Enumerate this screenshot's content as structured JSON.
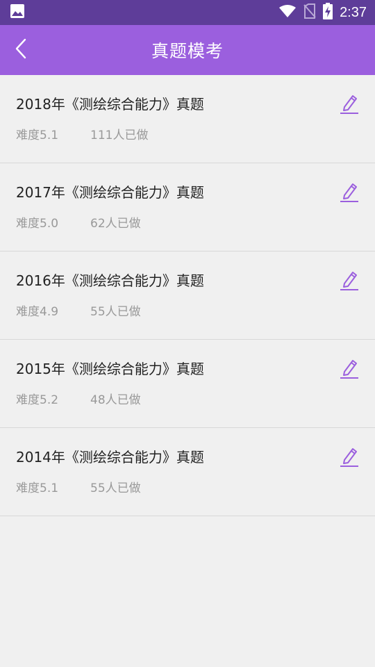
{
  "status_bar": {
    "time": "2:37",
    "icons": [
      "image-icon",
      "wifi-icon",
      "no-sim-icon",
      "battery-charging-icon"
    ]
  },
  "header": {
    "title": "真题模考",
    "back_icon": "back-arrow-icon"
  },
  "colors": {
    "status_bar": "#5e3d99",
    "app_bar": "#9b5fde",
    "accent": "#9b5fde",
    "background": "#f0f0f0"
  },
  "exams": [
    {
      "title": "2018年《测绘综合能力》真题",
      "difficulty": "难度5.1",
      "participants": "111人已做"
    },
    {
      "title": "2017年《测绘综合能力》真题",
      "difficulty": "难度5.0",
      "participants": "62人已做"
    },
    {
      "title": "2016年《测绘综合能力》真题",
      "difficulty": "难度4.9",
      "participants": "55人已做"
    },
    {
      "title": "2015年《测绘综合能力》真题",
      "difficulty": "难度5.2",
      "participants": "48人已做"
    },
    {
      "title": "2014年《测绘综合能力》真题",
      "difficulty": "难度5.1",
      "participants": "55人已做"
    }
  ]
}
